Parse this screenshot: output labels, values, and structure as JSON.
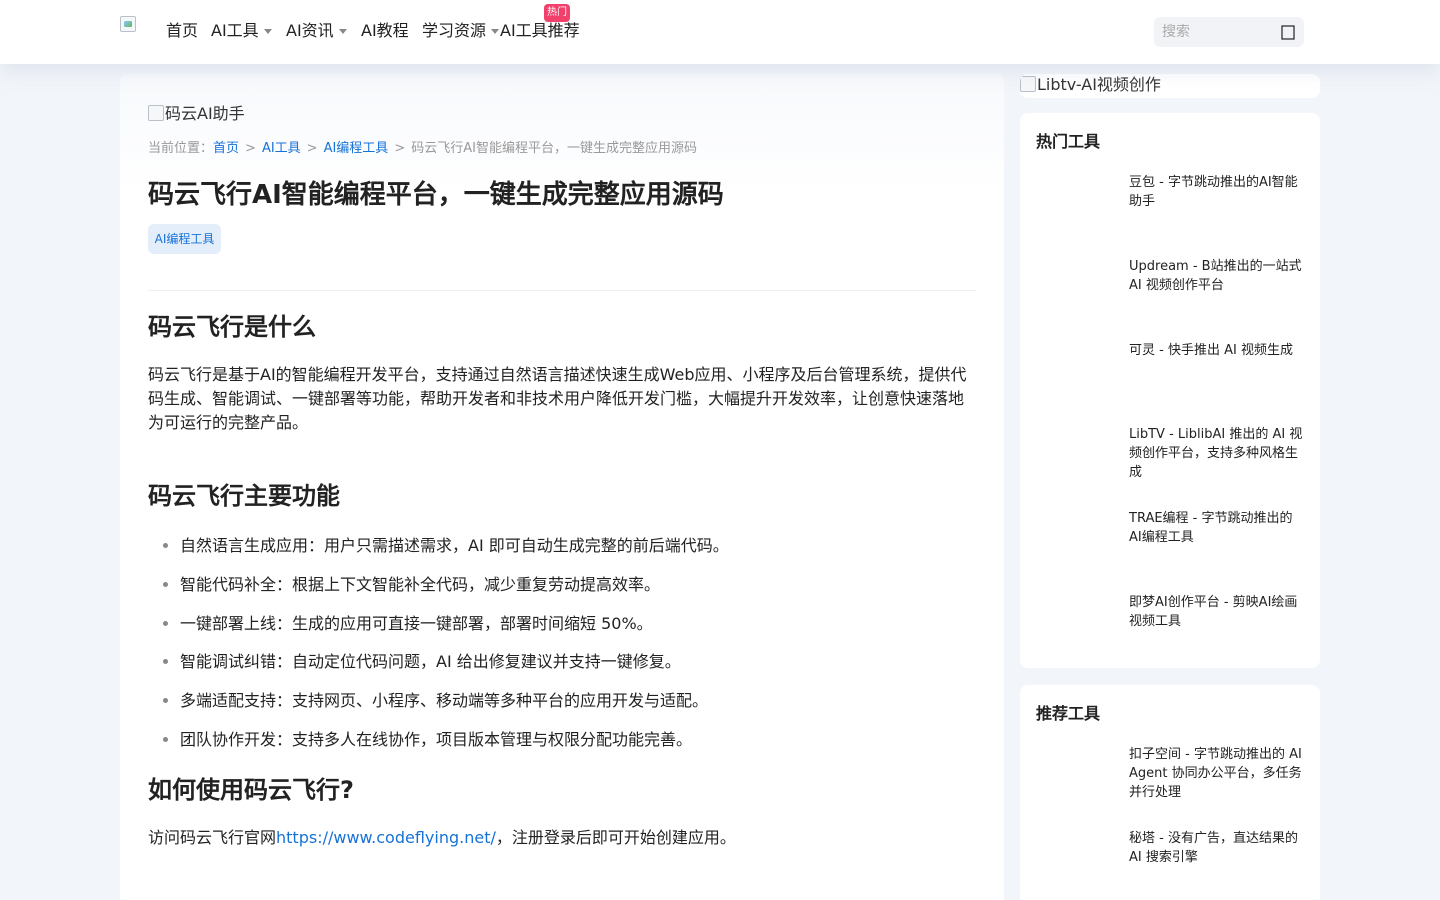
{
  "header": {
    "nav": [
      {
        "label": "首页",
        "dropdown": false
      },
      {
        "label": "AI工具",
        "dropdown": true
      },
      {
        "label": "AI资讯",
        "dropdown": true
      },
      {
        "label": "AI教程",
        "dropdown": false
      },
      {
        "label": "学习资源",
        "dropdown": true
      },
      {
        "label": "AI工具推荐",
        "dropdown": false
      }
    ],
    "hot_badge": "热门",
    "search": {
      "placeholder": "搜索"
    }
  },
  "main": {
    "hero_image_alt": "码云AI助手",
    "breadcrumb": {
      "prefix": "当前位置：",
      "items": [
        "首页",
        "AI工具",
        "AI编程工具"
      ],
      "current": "码云飞行AI智能编程平台，一键生成完整应用源码"
    },
    "title": "码云飞行AI智能编程平台，一键生成完整应用源码",
    "tag": "AI编程工具",
    "sections": [
      {
        "heading": "码云飞行是什么",
        "text": "码云飞行是基于AI的智能编程开发平台，支持通过自然语言描述快速生成Web应用、小程序及后台管理系统，提供代码生成、智能调试、一键部署等功能，帮助开发者和非技术用户降低开发门槛，大幅提升开发效率，让创意快速落地为可运行的完整产品。"
      },
      {
        "heading": "码云飞行主要功能",
        "features": [
          "自然语言生成应用：用户只需描述需求，AI 即可自动生成完整的前后端代码。",
          "智能代码补全：根据上下文智能补全代码，减少重复劳动提高效率。",
          "一键部署上线：生成的应用可直接一键部署，部署时间缩短 50%。",
          "智能调试纠错：自动定位代码问题，AI 给出修复建议并支持一键修复。",
          "多端适配支持：支持网页、小程序、移动端等多种平台的应用开发与适配。",
          "团队协作开发：支持多人在线协作，项目版本管理与权限分配功能完善。"
        ]
      },
      {
        "heading": "如何使用码云飞行?",
        "text_prefix": "访问码云飞行官网",
        "link": "https://www.codeflying.net/",
        "text_suffix": "，注册登录后即可开始创建应用。"
      }
    ]
  },
  "sidebar": {
    "ad_alt": "Libtv-AI视频创作",
    "hot_tools": {
      "title": "热门工具",
      "items": [
        "豆包 - 字节跳动推出的AI智能助手",
        "Updream - B站推出的一站式 AI 视频创作平台",
        "可灵 - 快手推出 AI 视频生成",
        "LibTV - LiblibAI 推出的 AI 视频创作平台，支持多种风格生成",
        "TRAE编程 - 字节跳动推出的AI编程工具",
        "即梦AI创作平台 - 剪映AI绘画视频工具"
      ]
    },
    "recommended": {
      "title": "推荐工具",
      "items": [
        "扣子空间 - 字节跳动推出的 AI Agent 协同办公平台，多任务并行处理",
        "秘塔 - 没有广告，直达结果的 AI 搜索引擎"
      ]
    }
  }
}
